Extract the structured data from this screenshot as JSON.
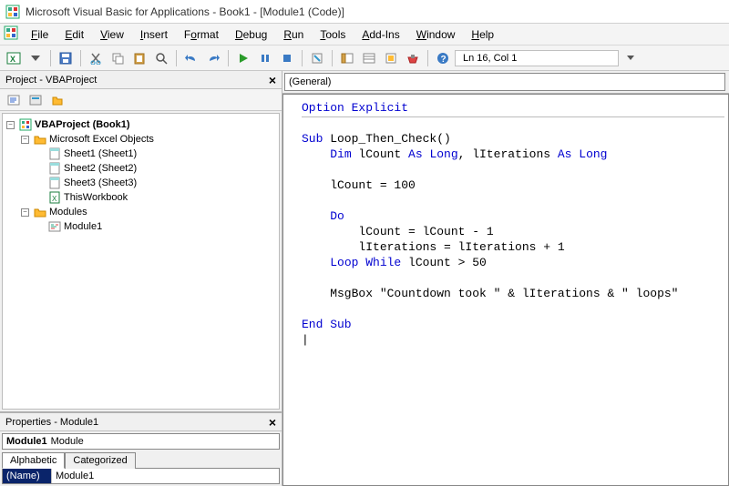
{
  "title": "Microsoft Visual Basic for Applications - Book1 - [Module1 (Code)]",
  "menu": [
    "File",
    "Edit",
    "View",
    "Insert",
    "Format",
    "Debug",
    "Run",
    "Tools",
    "Add-Ins",
    "Window",
    "Help"
  ],
  "status_pos": "Ln 16, Col 1",
  "project_pane": {
    "title": "Project - VBAProject",
    "root": "VBAProject (Book1)",
    "excel_folder": "Microsoft Excel Objects",
    "sheets": [
      "Sheet1 (Sheet1)",
      "Sheet2 (Sheet2)",
      "Sheet3 (Sheet3)"
    ],
    "thiswb": "ThisWorkbook",
    "modules_folder": "Modules",
    "modules": [
      "Module1"
    ]
  },
  "properties_pane": {
    "title": "Properties - Module1",
    "obj_name": "Module1",
    "obj_type": "Module",
    "tabs": [
      "Alphabetic",
      "Categorized"
    ],
    "row_name_label": "(Name)",
    "row_name_value": "Module1"
  },
  "code_dropdown": "(General)",
  "code": {
    "l1": "Option Explicit",
    "l2": "Sub Loop_Then_Check()",
    "l3": "    Dim lCount As Long, lIterations As Long",
    "l4": "    lCount = 100",
    "l5": "    Do",
    "l6": "        lCount = lCount - 1",
    "l7": "        lIterations = lIterations + 1",
    "l8": "    Loop While lCount > 50",
    "l9": "    MsgBox \"Countdown took \" & lIterations & \" loops\"",
    "l10": "End Sub"
  }
}
